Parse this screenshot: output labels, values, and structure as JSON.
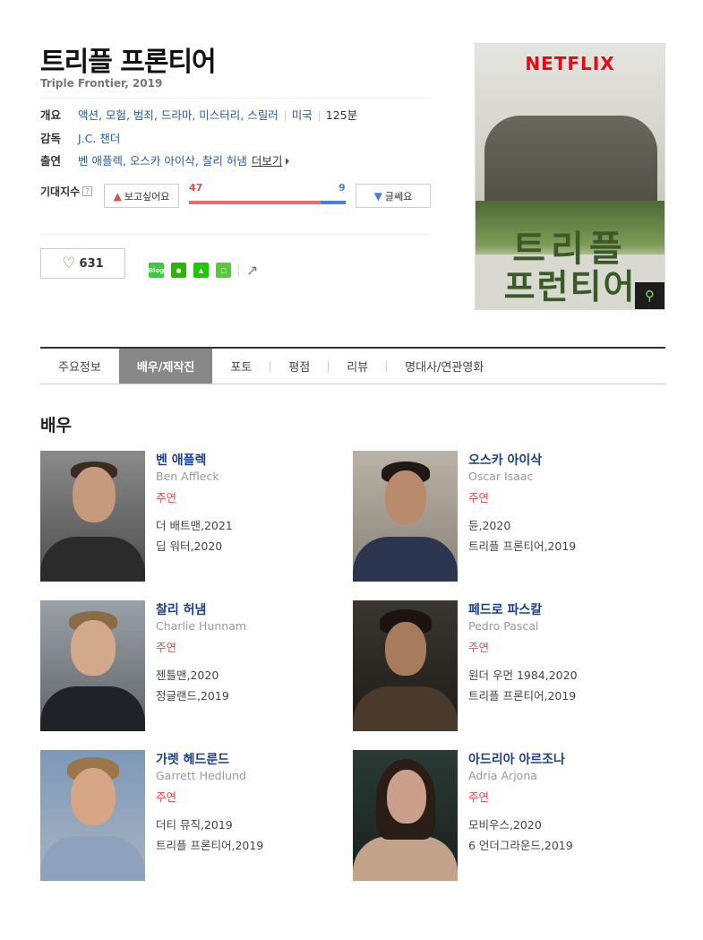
{
  "movie": {
    "title": "트리플 프론티어",
    "subtitle": "Triple Frontier, 2019"
  },
  "info": {
    "overview_key": "개요",
    "genres": "액션, 모험, 범죄, 드라마, 미스터리, 스릴러",
    "country": "미국",
    "runtime": "125분",
    "director_key": "감독",
    "director": "J.C. 챈더",
    "cast_key": "출연",
    "cast": "벤 애플렉, 오스카 아이삭, 찰리 허냄",
    "more": "더보기"
  },
  "expectation": {
    "label": "기대지수",
    "help": "?",
    "want_label": "보고싶어요",
    "nowant_label": "글쎄요",
    "want_count": "47",
    "nowant_count": "9",
    "want_ratio": 0.839
  },
  "like": {
    "count": "631"
  },
  "share": {
    "icons": [
      "line-icon",
      "talk-icon",
      "bookmark-icon",
      "memo-icon",
      "share-icon"
    ],
    "line_text": "Blog"
  },
  "poster": {
    "brand": "NETFLIX",
    "title_line1": "트리플",
    "title_line2": "프런티어",
    "zoom_icon": "search-icon"
  },
  "tabs": [
    {
      "label": "주요정보"
    },
    {
      "label": "배우/제작진",
      "active": true
    },
    {
      "label": "포토"
    },
    {
      "label": "평점"
    },
    {
      "label": "리뷰"
    },
    {
      "label": "명대사/연관영화"
    }
  ],
  "section": {
    "title": "배우"
  },
  "actors": [
    {
      "ko": "벤 애플렉",
      "en": "Ben Affleck",
      "role": "주연",
      "work1": "더 배트맨,2021",
      "work2": "딥 워터,2020"
    },
    {
      "ko": "오스카 아이삭",
      "en": "Oscar Isaac",
      "role": "주연",
      "work1": "듄,2020",
      "work2": "트리플 프론티어,2019"
    },
    {
      "ko": "찰리 허냄",
      "en": "Charlie Hunnam",
      "role": "주연",
      "work1": "젠틀맨,2020",
      "work2": "정글랜드,2019"
    },
    {
      "ko": "페드로 파스칼",
      "en": "Pedro Pascal",
      "role": "주연",
      "work1": "원더 우먼 1984,2020",
      "work2": "트리플 프론티어,2019"
    },
    {
      "ko": "가렛 헤드룬드",
      "en": "Garrett Hedlund",
      "role": "주연",
      "work1": "더티 뮤직,2019",
      "work2": "트리플 프론티어,2019"
    },
    {
      "ko": "아드리아 아르조나",
      "en": "Adria Arjona",
      "role": "주연",
      "work1": "모비우스,2020",
      "work2": "6 언더그라운드,2019"
    }
  ]
}
